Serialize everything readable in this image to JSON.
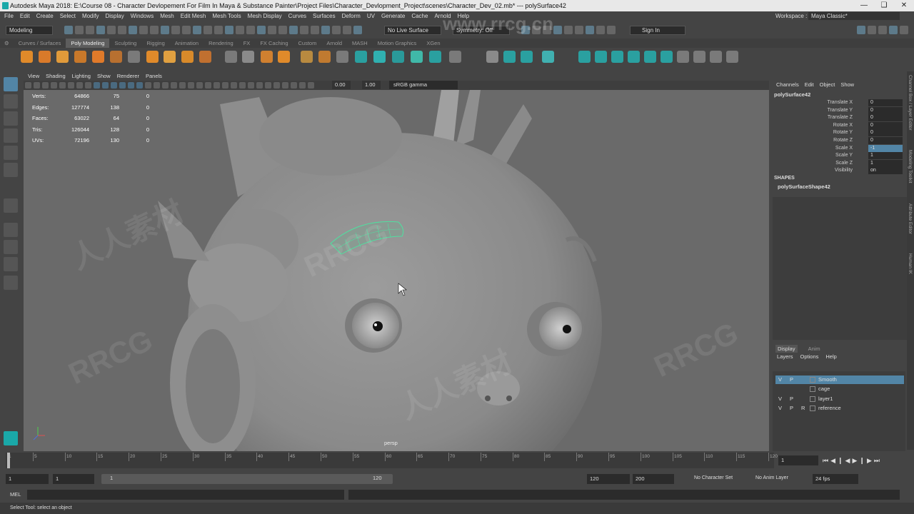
{
  "app": {
    "title": "Autodesk Maya 2018: E:\\Course 08 - Character Devlopement For Film In Maya & Substance Painter\\Project Files\\Character_Devlopment_Project\\scenes\\Character_Dev_02.mb*   ---   polySurface42"
  },
  "menus": [
    "File",
    "Edit",
    "Create",
    "Select",
    "Modify",
    "Display",
    "Windows",
    "Mesh",
    "Edit Mesh",
    "Mesh Tools",
    "Mesh Display",
    "Curves",
    "Surfaces",
    "Deform",
    "UV",
    "Generate",
    "Cache",
    "Arnold",
    "Help"
  ],
  "workspace": {
    "label": "Workspace :",
    "value": "Maya Classic*"
  },
  "status": {
    "mode": "Modeling",
    "live_surface": "No Live Surface",
    "symmetry": "Symmetry: Off",
    "sign_in": "Sign In"
  },
  "shelf_tabs": [
    "Curves / Surfaces",
    "Poly Modeling",
    "Sculpting",
    "Rigging",
    "Animation",
    "Rendering",
    "FX",
    "FX Caching",
    "Custom",
    "Arnold",
    "MASH",
    "Motion Graphics",
    "XGen"
  ],
  "shelf_active": "Poly Modeling",
  "panel_menu": [
    "View",
    "Shading",
    "Lighting",
    "Show",
    "Renderer",
    "Panels"
  ],
  "panel_tools": {
    "val1": "0.00",
    "val2": "1.00",
    "colorspace": "sRGB gamma"
  },
  "hud": [
    {
      "label": "Verts:",
      "a": "64866",
      "b": "75",
      "c": "0"
    },
    {
      "label": "Edges:",
      "a": "127774",
      "b": "138",
      "c": "0"
    },
    {
      "label": "Faces:",
      "a": "63022",
      "b": "64",
      "c": "0"
    },
    {
      "label": "Tris:",
      "a": "126044",
      "b": "128",
      "c": "0"
    },
    {
      "label": "UVs:",
      "a": "72196",
      "b": "130",
      "c": "0"
    }
  ],
  "camera_label": "persp",
  "channel_box": {
    "tabs": [
      "Channels",
      "Edit",
      "Object",
      "Show"
    ],
    "object": "polySurface42",
    "attrs": [
      {
        "name": "Translate X",
        "value": "0"
      },
      {
        "name": "Translate Y",
        "value": "0"
      },
      {
        "name": "Translate Z",
        "value": "0"
      },
      {
        "name": "Rotate X",
        "value": "0"
      },
      {
        "name": "Rotate Y",
        "value": "0"
      },
      {
        "name": "Rotate Z",
        "value": "0"
      },
      {
        "name": "Scale X",
        "value": "-1"
      },
      {
        "name": "Scale Y",
        "value": "1"
      },
      {
        "name": "Scale Z",
        "value": "1"
      },
      {
        "name": "Visibility",
        "value": "on"
      }
    ],
    "shapes_header": "SHAPES",
    "shape_name": "polySurfaceShape42"
  },
  "layer_editor": {
    "tabs": [
      "Display",
      "Anim"
    ],
    "menus": [
      "Layers",
      "Options",
      "Help"
    ],
    "layers": [
      {
        "v": "V",
        "p": "P",
        "r": "",
        "name": "Smooth",
        "selected": true
      },
      {
        "v": "",
        "p": "",
        "r": "",
        "name": "cage",
        "selected": false
      },
      {
        "v": "V",
        "p": "P",
        "r": "",
        "name": "layer1",
        "selected": false
      },
      {
        "v": "V",
        "p": "P",
        "r": "R",
        "name": "reference",
        "selected": false
      }
    ]
  },
  "side_labels": [
    "Channel Box / Layer Editor",
    "Modeling Toolkit",
    "Attribute Editor",
    "Human IK"
  ],
  "timeline": {
    "ticks": [
      "1",
      "5",
      "10",
      "15",
      "20",
      "25",
      "30",
      "35",
      "40",
      "45",
      "50",
      "55",
      "60",
      "65",
      "70",
      "75",
      "80",
      "85",
      "90",
      "95",
      "100",
      "105",
      "110",
      "115",
      "120"
    ],
    "current": "1"
  },
  "range": {
    "start": "1",
    "start2": "1",
    "slider_start": "1",
    "slider_end": "120",
    "end": "120",
    "end2": "200",
    "char_set": "No Character Set",
    "anim_layer": "No Anim Layer",
    "fps": "24 fps"
  },
  "cmd": {
    "label": "MEL"
  },
  "help": "Select Tool: select an object",
  "watermark": {
    "text1": "RRCG",
    "text2": "人人素材",
    "url": "www.rrcg.cn"
  },
  "colors": {
    "accent": "#5285a6",
    "selected_layer": "#5285a6",
    "wire": "#4fe0a0"
  }
}
